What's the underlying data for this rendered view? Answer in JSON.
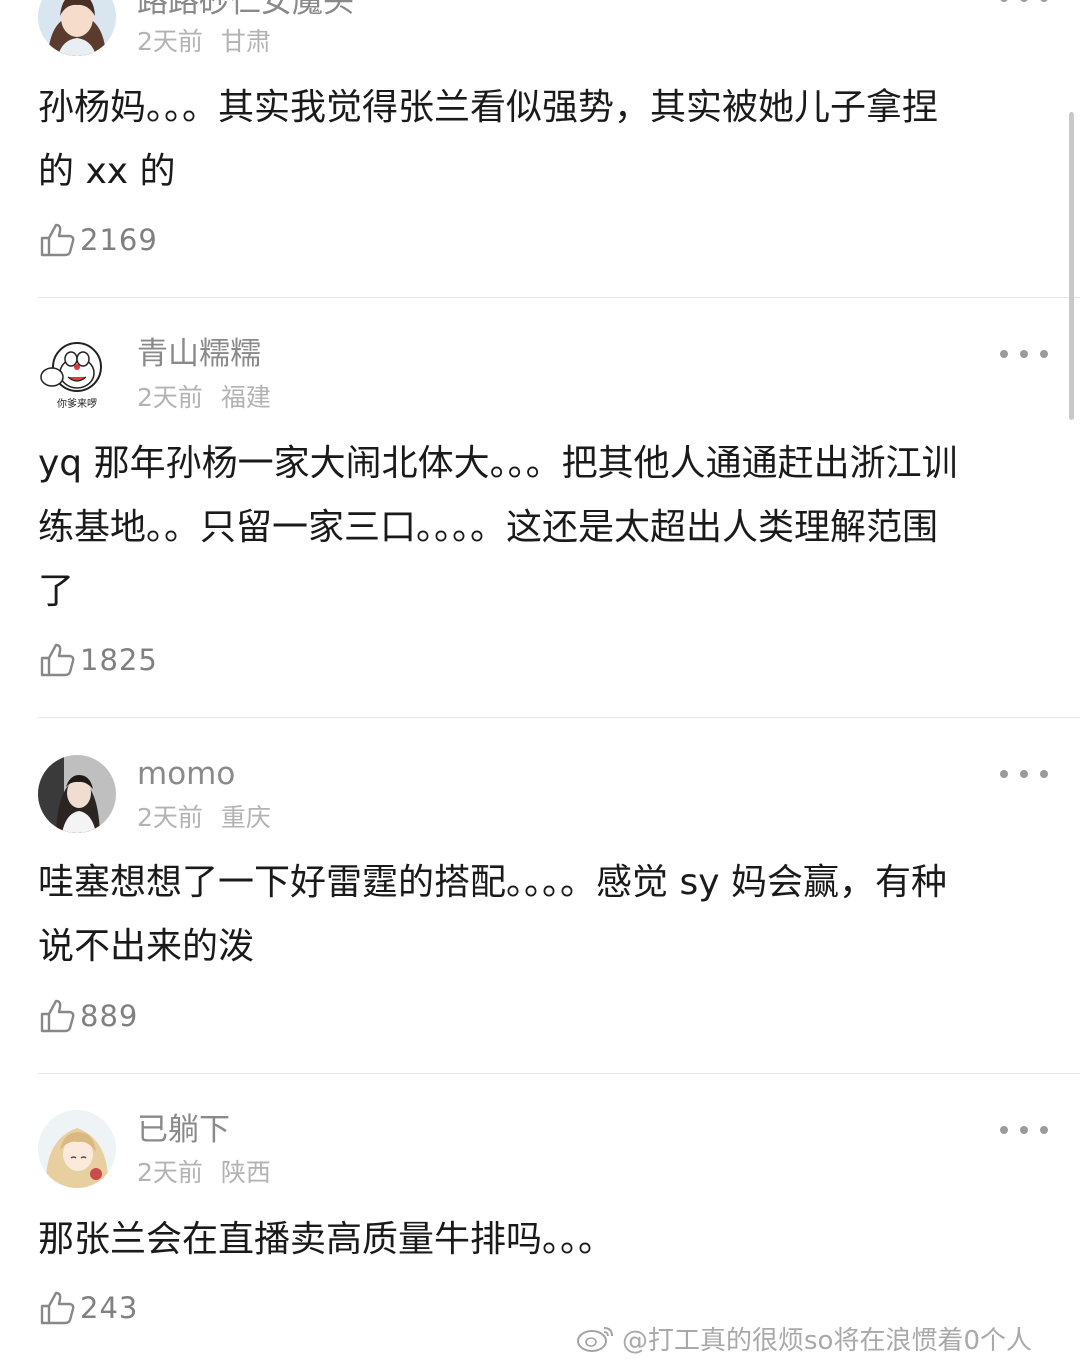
{
  "comments": [
    {
      "username": "路路砂仁女魔头",
      "time": "2天前",
      "location": "甘肃",
      "text_lines": [
        "孙杨妈。。。其实我觉得张兰看似强势，其实被她儿子拿捏",
        "的 xx 的"
      ],
      "likes": "2169",
      "avatar_icon": "girl-portrait-avatar"
    },
    {
      "username": "青山糯糯",
      "time": "2天前",
      "location": "福建",
      "text_lines": [
        "yq 那年孙杨一家大闹北体大。。。把其他人通通赶出浙江训",
        "练基地。。只留一家三口。。。。这还是太超出人类理解范围",
        "了"
      ],
      "likes": "1825",
      "avatar_icon": "doraemon-sticker-avatar",
      "avatar_caption": "你爹来啰"
    },
    {
      "username": "momo",
      "time": "2天前",
      "location": "重庆",
      "text_lines": [
        "哇塞想想了一下好雷霆的搭配。。。。感觉 sy 妈会赢，有种",
        "说不出来的泼"
      ],
      "likes": "889",
      "avatar_icon": "woman-photo-avatar"
    },
    {
      "username": "已躺下",
      "time": "2天前",
      "location": "陕西",
      "text_lines": [
        "那张兰会在直播卖高质量牛排吗。。。"
      ],
      "likes": "243",
      "avatar_icon": "anime-character-avatar"
    }
  ],
  "watermark": {
    "text": "@打工真的很烦so将在浪惯着0个人",
    "icon": "weibo-logo-icon"
  },
  "colors": {
    "text": "#1a1a1a",
    "username": "#8a8a8a",
    "meta": "#b3b3b3",
    "like_count": "#808080",
    "divider": "#e6e6e6"
  }
}
